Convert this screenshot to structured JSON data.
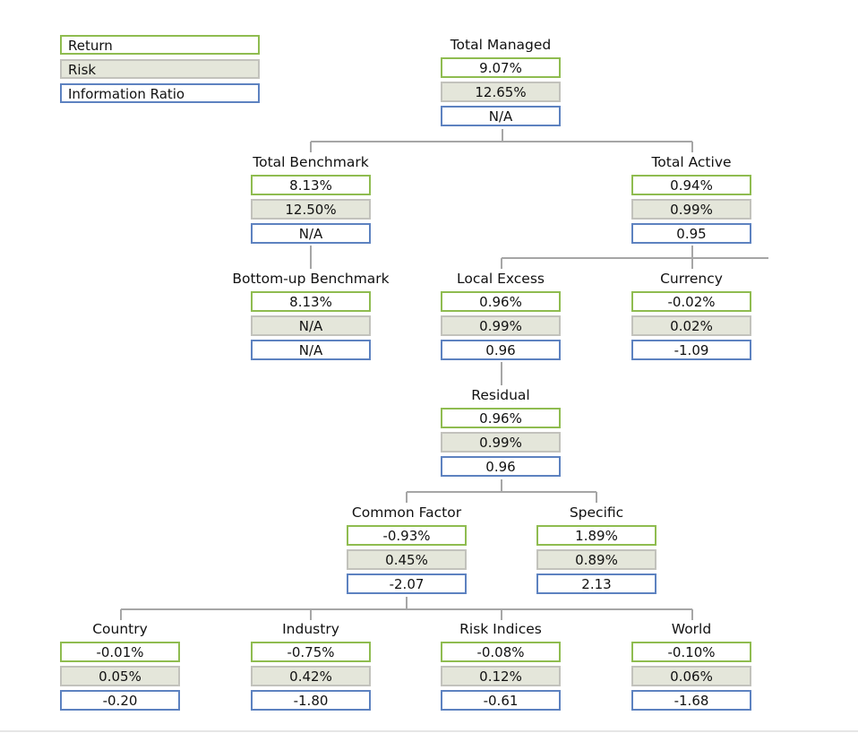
{
  "colors": {
    "return_border": "#8fbc50",
    "risk_border": "#c2c2bc",
    "risk_fill": "#e4e6da",
    "ir_border": "#5d82c0",
    "connector": "#a6a6a6"
  },
  "legend": {
    "return_label": "Return",
    "risk_label": "Risk",
    "information_ratio_label": "Information Ratio"
  },
  "nodes": {
    "total_managed": {
      "title": "Total Managed",
      "return": "9.07%",
      "risk": "12.65%",
      "ir": "N/A"
    },
    "total_benchmark": {
      "title": "Total Benchmark",
      "return": "8.13%",
      "risk": "12.50%",
      "ir": "N/A"
    },
    "total_active": {
      "title": "Total Active",
      "return": "0.94%",
      "risk": "0.99%",
      "ir": "0.95"
    },
    "bottom_up_benchmark": {
      "title": "Bottom-up Benchmark",
      "return": "8.13%",
      "risk": "N/A",
      "ir": "N/A"
    },
    "local_excess": {
      "title": "Local Excess",
      "return": "0.96%",
      "risk": "0.99%",
      "ir": "0.96"
    },
    "currency": {
      "title": "Currency",
      "return": "-0.02%",
      "risk": "0.02%",
      "ir": "-1.09"
    },
    "residual": {
      "title": "Residual",
      "return": "0.96%",
      "risk": "0.99%",
      "ir": "0.96"
    },
    "common_factor": {
      "title": "Common Factor",
      "return": "-0.93%",
      "risk": "0.45%",
      "ir": "-2.07"
    },
    "specific": {
      "title": "Specific",
      "return": "1.89%",
      "risk": "0.89%",
      "ir": "2.13"
    },
    "country": {
      "title": "Country",
      "return": "-0.01%",
      "risk": "0.05%",
      "ir": "-0.20"
    },
    "industry": {
      "title": "Industry",
      "return": "-0.75%",
      "risk": "0.42%",
      "ir": "-1.80"
    },
    "risk_indices": {
      "title": "Risk Indices",
      "return": "-0.08%",
      "risk": "0.12%",
      "ir": "-0.61"
    },
    "world": {
      "title": "World",
      "return": "-0.10%",
      "risk": "0.06%",
      "ir": "-1.68"
    }
  }
}
